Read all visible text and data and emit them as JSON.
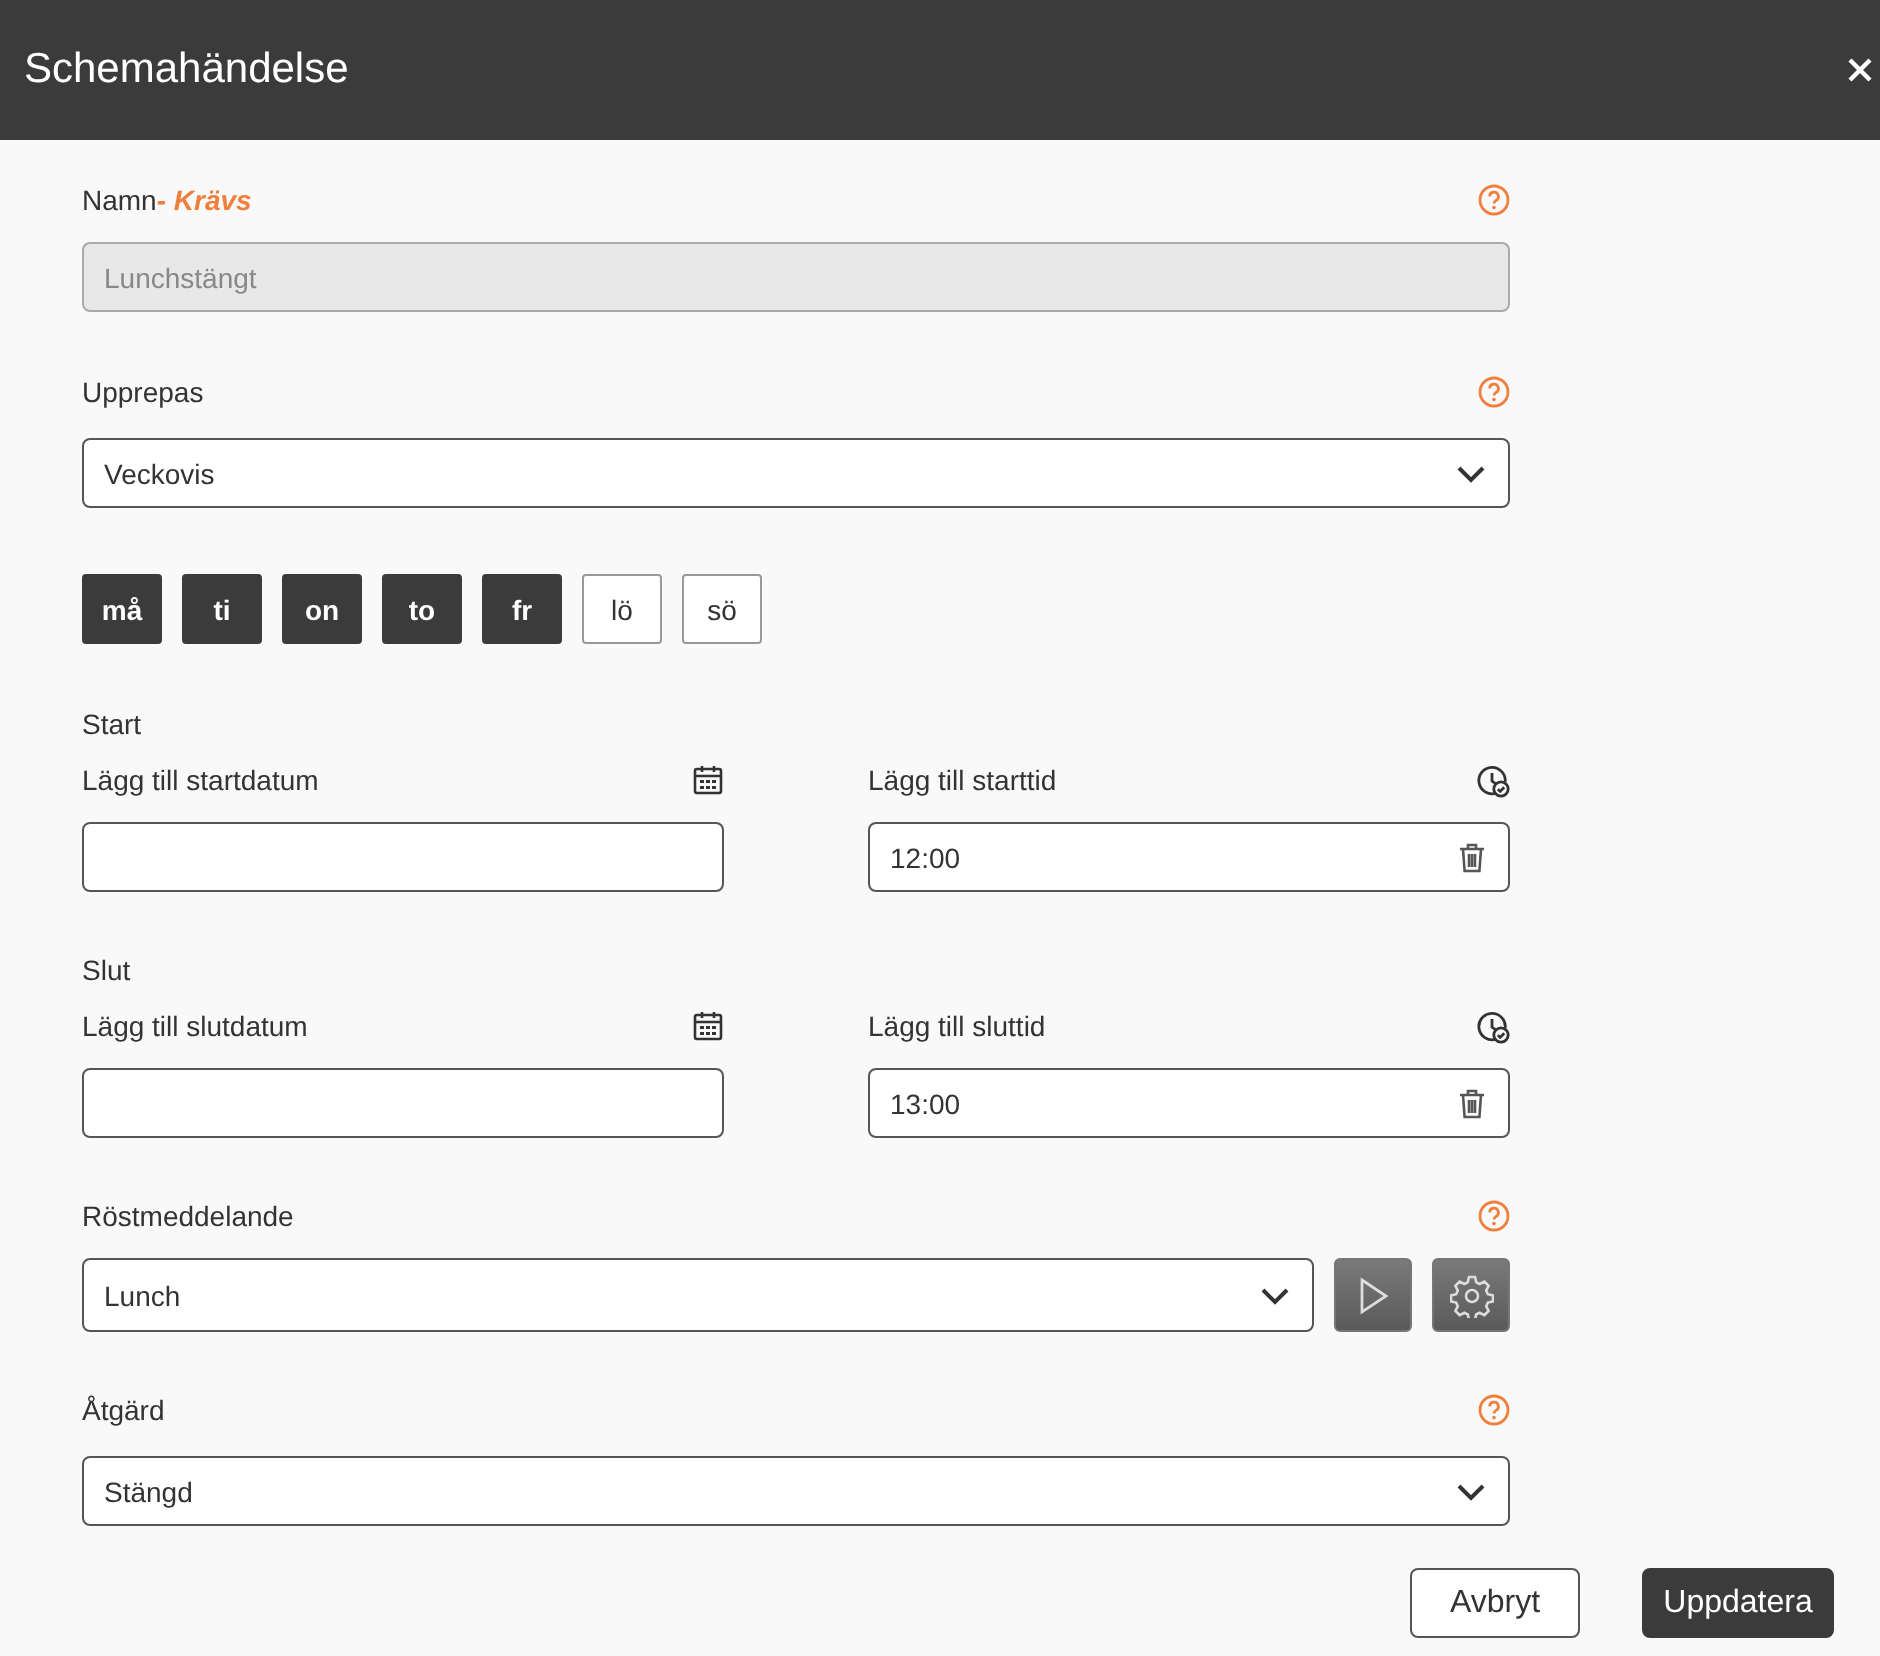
{
  "dialog": {
    "title": "Schemahändelse"
  },
  "name_field": {
    "label": "Namn",
    "required": "- Krävs",
    "value": "Lunchstängt",
    "disabled": true
  },
  "repeat": {
    "label": "Upprepas",
    "value": "Veckovis"
  },
  "days": [
    {
      "label": "må",
      "selected": true
    },
    {
      "label": "ti",
      "selected": true
    },
    {
      "label": "on",
      "selected": true
    },
    {
      "label": "to",
      "selected": true
    },
    {
      "label": "fr",
      "selected": true
    },
    {
      "label": "lö",
      "selected": false
    },
    {
      "label": "sö",
      "selected": false
    }
  ],
  "start": {
    "heading": "Start",
    "date": {
      "label": "Lägg till startdatum"
    },
    "time": {
      "label": "Lägg till starttid",
      "value": "12:00"
    }
  },
  "end": {
    "heading": "Slut",
    "date": {
      "label": "Lägg till slutdatum"
    },
    "time": {
      "label": "Lägg till sluttid",
      "value": "13:00"
    }
  },
  "voice": {
    "label": "Röstmeddelande",
    "value": "Lunch"
  },
  "action": {
    "label": "Åtgärd",
    "value": "Stängd"
  },
  "buttons": [
    {
      "label": "Avbryt",
      "kind": "secondary"
    },
    {
      "label": "Uppdatera",
      "kind": "primary"
    }
  ]
}
